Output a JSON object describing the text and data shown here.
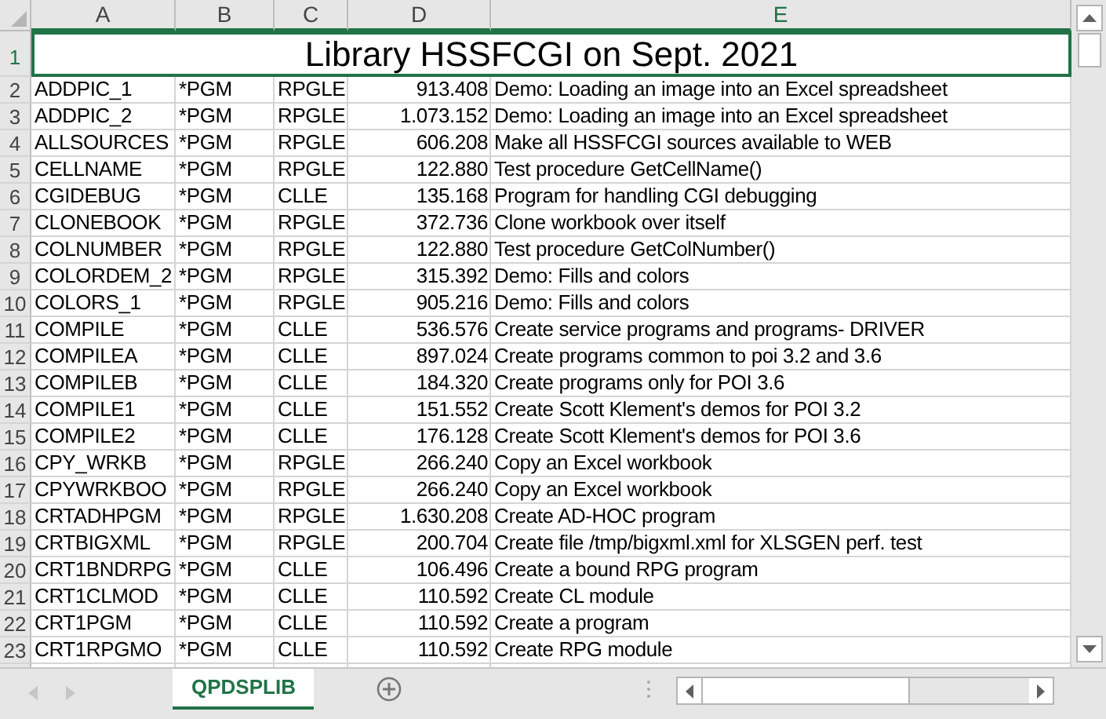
{
  "columns": [
    "A",
    "B",
    "C",
    "D",
    "E"
  ],
  "title_row": {
    "num": "1",
    "text": "Library HSSFCGI on Sept. 2021"
  },
  "rows": [
    {
      "num": "2",
      "cells": [
        "ADDPIC_1",
        "*PGM",
        "RPGLE",
        "913.408",
        "Demo: Loading an image into an Excel spreadsheet"
      ]
    },
    {
      "num": "3",
      "cells": [
        "ADDPIC_2",
        "*PGM",
        "RPGLE",
        "1.073.152",
        "Demo: Loading an image into an Excel spreadsheet"
      ]
    },
    {
      "num": "4",
      "cells": [
        "ALLSOURCES",
        "*PGM",
        "RPGLE",
        "606.208",
        "Make all HSSFCGI sources available to WEB"
      ]
    },
    {
      "num": "5",
      "cells": [
        "CELLNAME",
        "*PGM",
        "RPGLE",
        "122.880",
        "Test procedure GetCellName()"
      ]
    },
    {
      "num": "6",
      "cells": [
        "CGIDEBUG",
        "*PGM",
        "CLLE",
        "135.168",
        "Program for handling CGI debugging"
      ]
    },
    {
      "num": "7",
      "cells": [
        "CLONEBOOK",
        "*PGM",
        "RPGLE",
        "372.736",
        "Clone workbook over itself"
      ]
    },
    {
      "num": "8",
      "cells": [
        "COLNUMBER",
        "*PGM",
        "RPGLE",
        "122.880",
        "Test procedure GetColNumber()"
      ]
    },
    {
      "num": "9",
      "cells": [
        "COLORDEM_2",
        "*PGM",
        "RPGLE",
        "315.392",
        "Demo: Fills and colors"
      ]
    },
    {
      "num": "10",
      "cells": [
        "COLORS_1",
        "*PGM",
        "RPGLE",
        "905.216",
        "Demo: Fills and colors"
      ]
    },
    {
      "num": "11",
      "cells": [
        "COMPILE",
        "*PGM",
        "CLLE",
        "536.576",
        "Create service programs and programs- DRIVER"
      ]
    },
    {
      "num": "12",
      "cells": [
        "COMPILEA",
        "*PGM",
        "CLLE",
        "897.024",
        "Create programs common to poi 3.2 and 3.6"
      ]
    },
    {
      "num": "13",
      "cells": [
        "COMPILEB",
        "*PGM",
        "CLLE",
        "184.320",
        "Create programs only for POI 3.6"
      ]
    },
    {
      "num": "14",
      "cells": [
        "COMPILE1",
        "*PGM",
        "CLLE",
        "151.552",
        "Create Scott Klement's demos for POI 3.2"
      ]
    },
    {
      "num": "15",
      "cells": [
        "COMPILE2",
        "*PGM",
        "CLLE",
        "176.128",
        "Create Scott Klement's demos for POI 3.6"
      ]
    },
    {
      "num": "16",
      "cells": [
        "CPY_WRKB",
        "*PGM",
        "RPGLE",
        "266.240",
        "Copy an Excel workbook"
      ]
    },
    {
      "num": "17",
      "cells": [
        "CPYWRKBOO",
        "*PGM",
        "RPGLE",
        "266.240",
        "Copy an Excel workbook"
      ]
    },
    {
      "num": "18",
      "cells": [
        "CRTADHPGM",
        "*PGM",
        "RPGLE",
        "1.630.208",
        "Create AD-HOC program"
      ]
    },
    {
      "num": "19",
      "cells": [
        "CRTBIGXML",
        "*PGM",
        "RPGLE",
        "200.704",
        "Create file /tmp/bigxml.xml for XLSGEN perf. test"
      ]
    },
    {
      "num": "20",
      "cells": [
        "CRT1BNDRPG",
        "*PGM",
        "CLLE",
        "106.496",
        "Create a bound RPG program"
      ]
    },
    {
      "num": "21",
      "cells": [
        "CRT1CLMOD",
        "*PGM",
        "CLLE",
        "110.592",
        "Create CL  module"
      ]
    },
    {
      "num": "22",
      "cells": [
        "CRT1PGM",
        "*PGM",
        "CLLE",
        "110.592",
        "Create a program"
      ]
    },
    {
      "num": "23",
      "cells": [
        "CRT1RPGMO",
        "*PGM",
        "CLLE",
        "110.592",
        "Create RPG module"
      ]
    }
  ],
  "sheet_tabs": [
    {
      "label": "QPDSPLIB",
      "selected": true
    }
  ]
}
